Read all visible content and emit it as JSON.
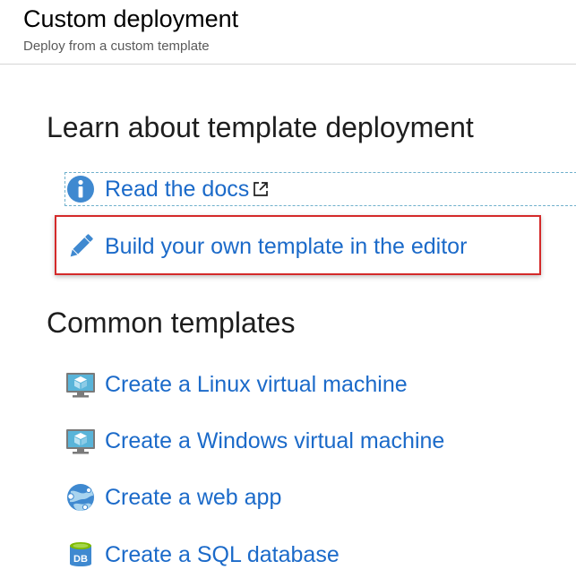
{
  "header": {
    "title": "Custom deployment",
    "subtitle": "Deploy from a custom template"
  },
  "learn": {
    "title": "Learn about template deployment",
    "links": [
      {
        "label": "Read the docs",
        "icon": "info-icon"
      },
      {
        "label": "Build your own template in the editor",
        "icon": "pencil-icon"
      }
    ]
  },
  "common": {
    "title": "Common templates",
    "links": [
      {
        "label": "Create a Linux virtual machine",
        "icon": "virtual-machine-icon"
      },
      {
        "label": "Create a Windows virtual machine",
        "icon": "virtual-machine-icon"
      },
      {
        "label": "Create a web app",
        "icon": "web-app-icon"
      },
      {
        "label": "Create a SQL database",
        "icon": "sql-database-icon",
        "icon_text": "DB"
      }
    ]
  },
  "colors": {
    "link": "#1b6ac9",
    "highlight_border": "#d42a2a",
    "focus_border": "#6fb0cc",
    "icon_blue": "#3f89d0"
  }
}
